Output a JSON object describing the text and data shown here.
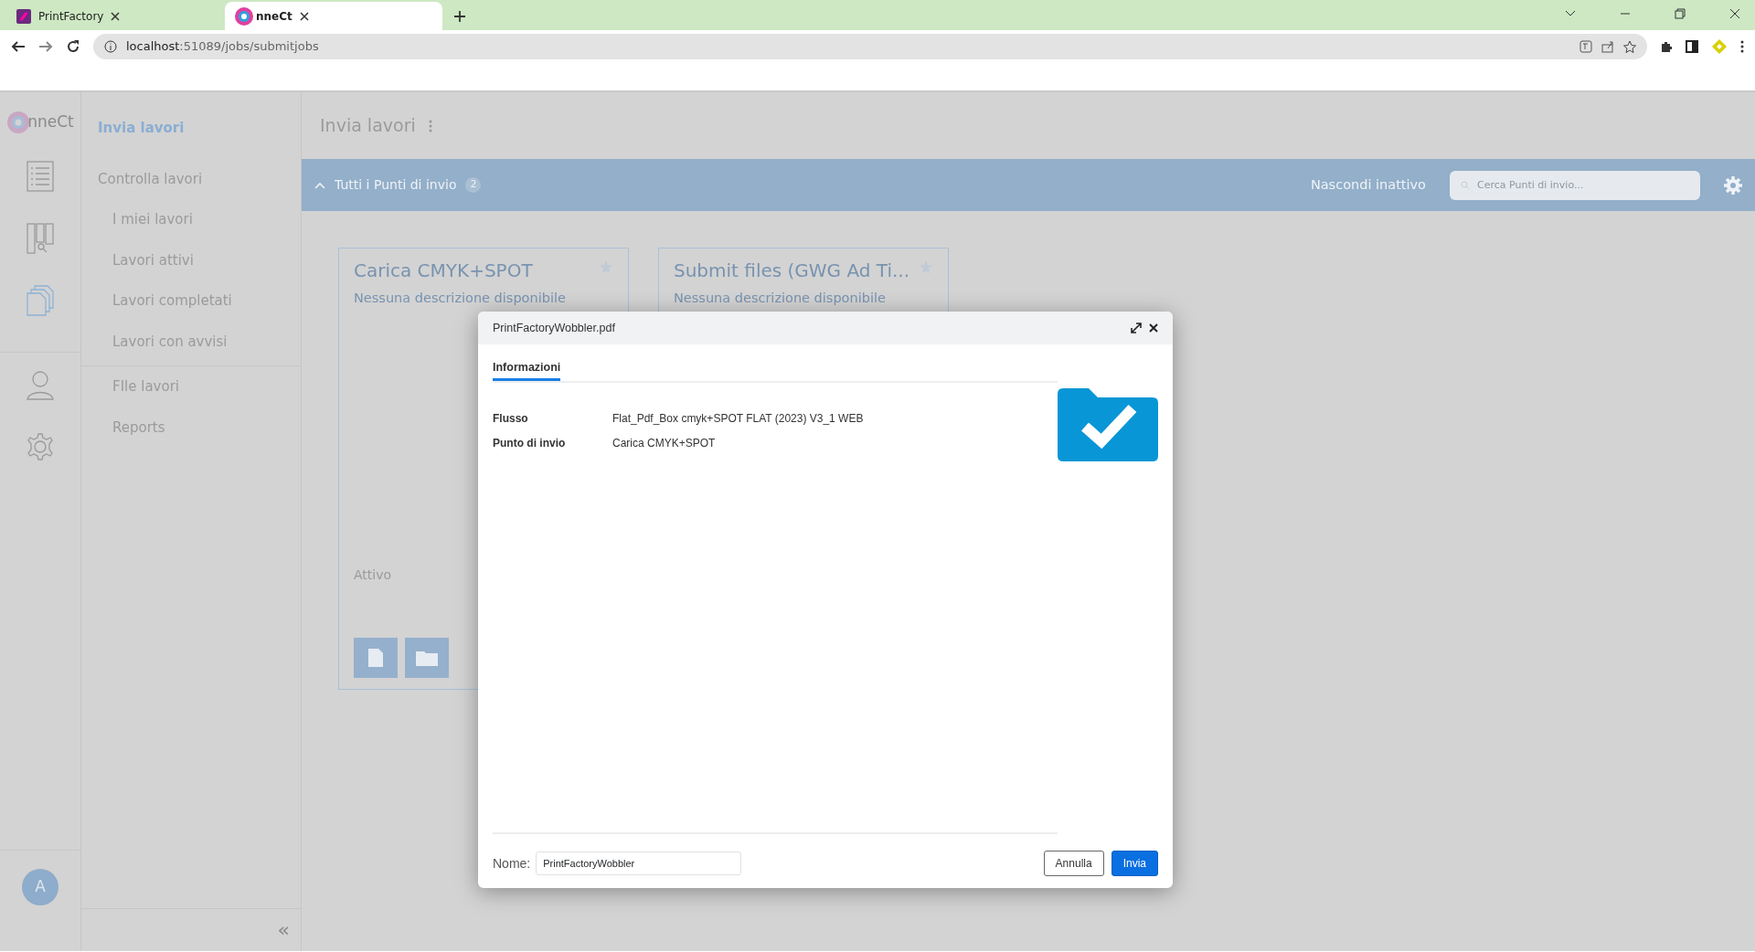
{
  "browser": {
    "tabs": [
      {
        "title": "PrintFactory",
        "selected": false
      },
      {
        "title": "nneCt",
        "selected": true
      }
    ],
    "url": {
      "host": "localhost",
      "path": ":51089/jobs/submitjobs"
    }
  },
  "app": {
    "logo_text": "nneCt",
    "rail": [
      {
        "kind": "list",
        "selected": false
      },
      {
        "kind": "board",
        "selected": false
      },
      {
        "kind": "copies",
        "selected": true
      },
      {
        "kind": "user",
        "selected": false
      },
      {
        "kind": "gear",
        "selected": false
      }
    ],
    "avatar": "A",
    "nav": [
      {
        "label": "Invia lavori",
        "kind": "main",
        "selected": true
      },
      {
        "label": "Controlla lavori",
        "kind": "main",
        "selected": false,
        "children": [
          {
            "label": "I miei lavori",
            "selected": false
          },
          {
            "label": "Lavori attivi",
            "selected": false
          },
          {
            "label": "Lavori completati",
            "selected": false
          },
          {
            "label": "Lavori con avvisi",
            "selected": false
          }
        ]
      },
      {
        "label": "FIle lavori",
        "kind": "sub",
        "selected": false
      },
      {
        "label": "Reports",
        "kind": "sub",
        "selected": false
      }
    ],
    "collapse": "«"
  },
  "header": {
    "title": "Invia lavori"
  },
  "bar": {
    "label": "Tutti i Punti di invio",
    "count": "2",
    "hide_inactive": "Nascondi inattivo",
    "search": {
      "placeholder": "Cerca Punti di invio..."
    }
  },
  "cards": [
    {
      "title": "Carica CMYK+SPOT",
      "description": "Nessuna descrizione disponibile",
      "status": "Attivo"
    },
    {
      "title": "Submit files (GWG Ad Ti...",
      "description": "Nessuna descrizione disponibile"
    }
  ],
  "dialog": {
    "title": "PrintFactoryWobbler.pdf",
    "tabs": [
      {
        "label": "Informazioni",
        "selected": true
      }
    ],
    "fields": [
      {
        "label": "Flusso",
        "value": "Flat_Pdf_Box cmyk+SPOT FLAT (2023) V3_1 WEB"
      },
      {
        "label": "Punto di invio",
        "value": "Carica CMYK+SPOT"
      }
    ],
    "name_label": "Nome:",
    "name_value": "PrintFactoryWobbler",
    "buttons": [
      {
        "label": "Annulla",
        "kind": "secondary"
      },
      {
        "label": "Invia",
        "kind": "primary"
      }
    ]
  }
}
